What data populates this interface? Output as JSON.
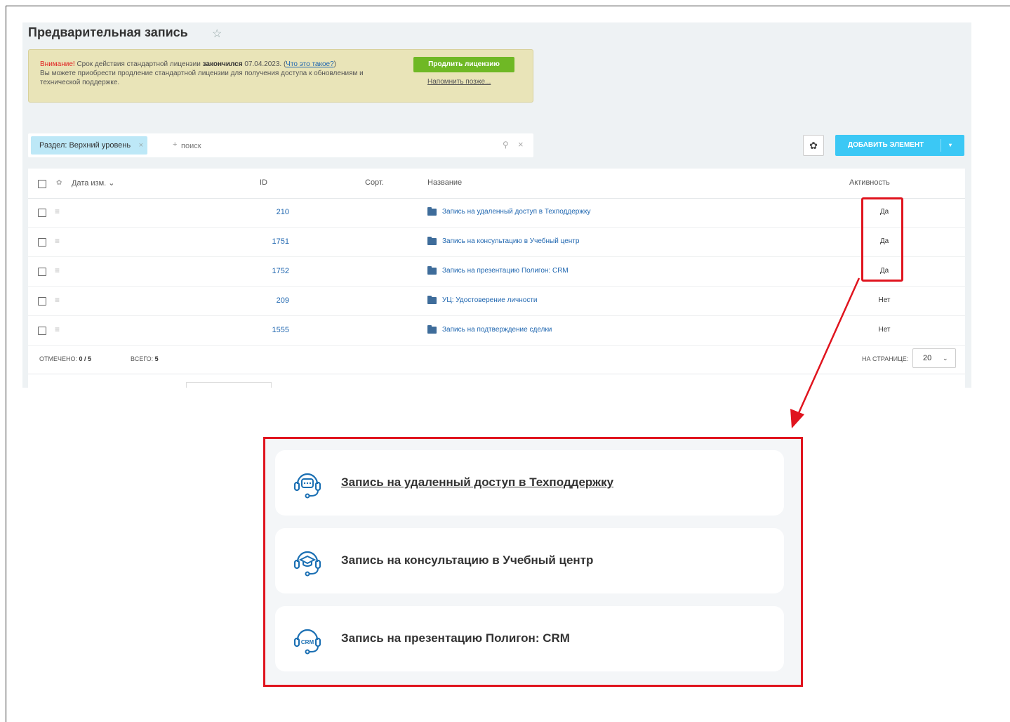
{
  "page": {
    "title": "Предварительная запись"
  },
  "notice": {
    "warning": "Внимание!",
    "text1": " Срок действия стандартной лицензии ",
    "expired": "закончился",
    "date": " 07.04.2023. (",
    "link": "Что это такое?",
    "close_paren": ")",
    "text2": "Вы можете приобрести продление стандартной лицензии для получения доступа к обновлениям и технической поддержке.",
    "renew_button": "Продлить лицензию",
    "remind_link": "Напомнить позже..."
  },
  "filter": {
    "tag": "Раздел: Верхний уровень",
    "tag_close": "×",
    "plus": "+",
    "placeholder": "поиск",
    "search_icon": "⚲",
    "clear_icon": "×"
  },
  "toolbar": {
    "add_label": "ДОБАВИТЬ ЭЛЕМЕНТ",
    "caret": "▾",
    "gear": "✿"
  },
  "grid": {
    "columns": {
      "date": "Дата изм.",
      "date_caret": "⌄",
      "id": "ID",
      "sort": "Сорт.",
      "name": "Название",
      "active": "Активность"
    },
    "rows": [
      {
        "id": "210",
        "name": "Запись на удаленный доступ в Техподдержку",
        "active": "Да"
      },
      {
        "id": "1751",
        "name": "Запись на консультацию в Учебный центр",
        "active": "Да"
      },
      {
        "id": "1752",
        "name": "Запись на презентацию Полигон: CRM",
        "active": "Да"
      },
      {
        "id": "209",
        "name": "УЦ: Удостоверение личности",
        "active": "Нет"
      },
      {
        "id": "1555",
        "name": "Запись на подтверждение сделки",
        "active": "Нет"
      }
    ],
    "footer": {
      "selected_label": "ОТМЕЧЕНО:",
      "selected_value": "0 / 5",
      "total_label": "ВСЕГО:",
      "total_value": "5",
      "per_page_label": "НА СТРАНИЦЕ:",
      "per_page_value": "20",
      "per_page_chev": "⌄"
    }
  },
  "preview": {
    "cards": [
      {
        "title": "Запись на удаленный доступ в Техподдержку",
        "icon": "headset-chat-icon"
      },
      {
        "title": "Запись на консультацию в Учебный центр",
        "icon": "headset-graduation-icon"
      },
      {
        "title": "Запись на презентацию Полигон: CRM",
        "icon": "headset-crm-icon",
        "icon_text": "CRM"
      }
    ]
  },
  "colors": {
    "highlight": "#e0141e",
    "accent": "#3bc8f5",
    "renew": "#6fb825",
    "link": "#2067b0"
  }
}
